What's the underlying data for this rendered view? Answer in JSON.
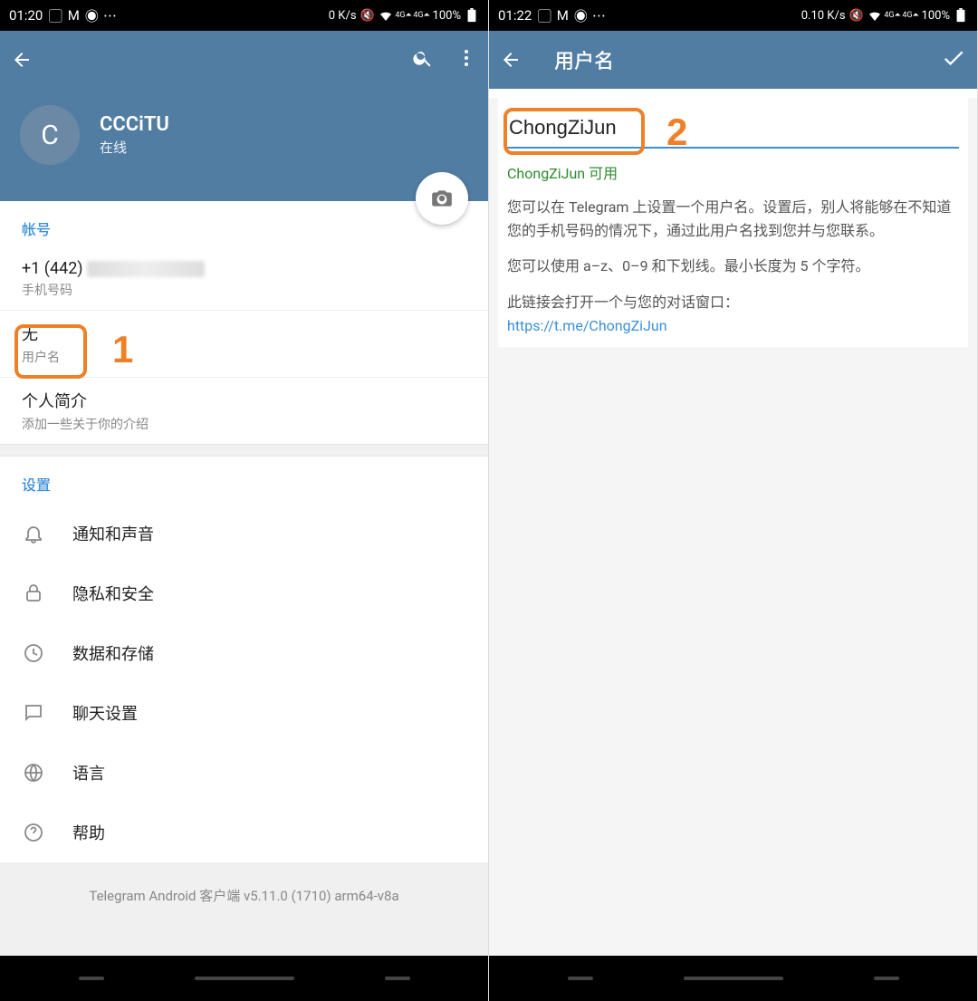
{
  "left": {
    "status": {
      "time": "01:20",
      "net": "0 K/s",
      "battery": "100%"
    },
    "toolbar": {
      "search_name": "search-icon",
      "more_name": "more-icon"
    },
    "profile": {
      "avatar_letter": "C",
      "name": "CCCiTU",
      "status": "在线"
    },
    "account": {
      "header": "帐号",
      "phone_value": "+1 (442)",
      "phone_label": "手机号码",
      "username_value": "无",
      "username_label": "用户名",
      "bio_value": "个人简介",
      "bio_label": "添加一些关于你的介绍"
    },
    "settings": {
      "header": "设置",
      "items": [
        {
          "label": "通知和声音",
          "icon": "bell-icon"
        },
        {
          "label": "隐私和安全",
          "icon": "lock-icon"
        },
        {
          "label": "数据和存储",
          "icon": "clock-icon"
        },
        {
          "label": "聊天设置",
          "icon": "chat-icon"
        },
        {
          "label": "语言",
          "icon": "globe-icon"
        },
        {
          "label": "帮助",
          "icon": "help-icon"
        }
      ]
    },
    "footer_version": "Telegram Android 客户端 v5.11.0 (1710) arm64-v8a",
    "annotation_number": "1"
  },
  "right": {
    "status": {
      "time": "01:22",
      "net": "0.10 K/s",
      "battery": "100%"
    },
    "toolbar": {
      "title": "用户名"
    },
    "username_input_value": "ChongZiJun",
    "username_available": "ChongZiJun 可用",
    "para1": "您可以在 Telegram 上设置一个用户名。设置后，别人将能够在不知道您的手机号码的情况下，通过此用户名找到您并与您联系。",
    "para2": "您可以使用 a–z、0–9 和下划线。最小长度为 5 个字符。",
    "para3": "此链接会打开一个与您的对话窗口：",
    "link": "https://t.me/ChongZiJun",
    "annotation_number": "2"
  }
}
